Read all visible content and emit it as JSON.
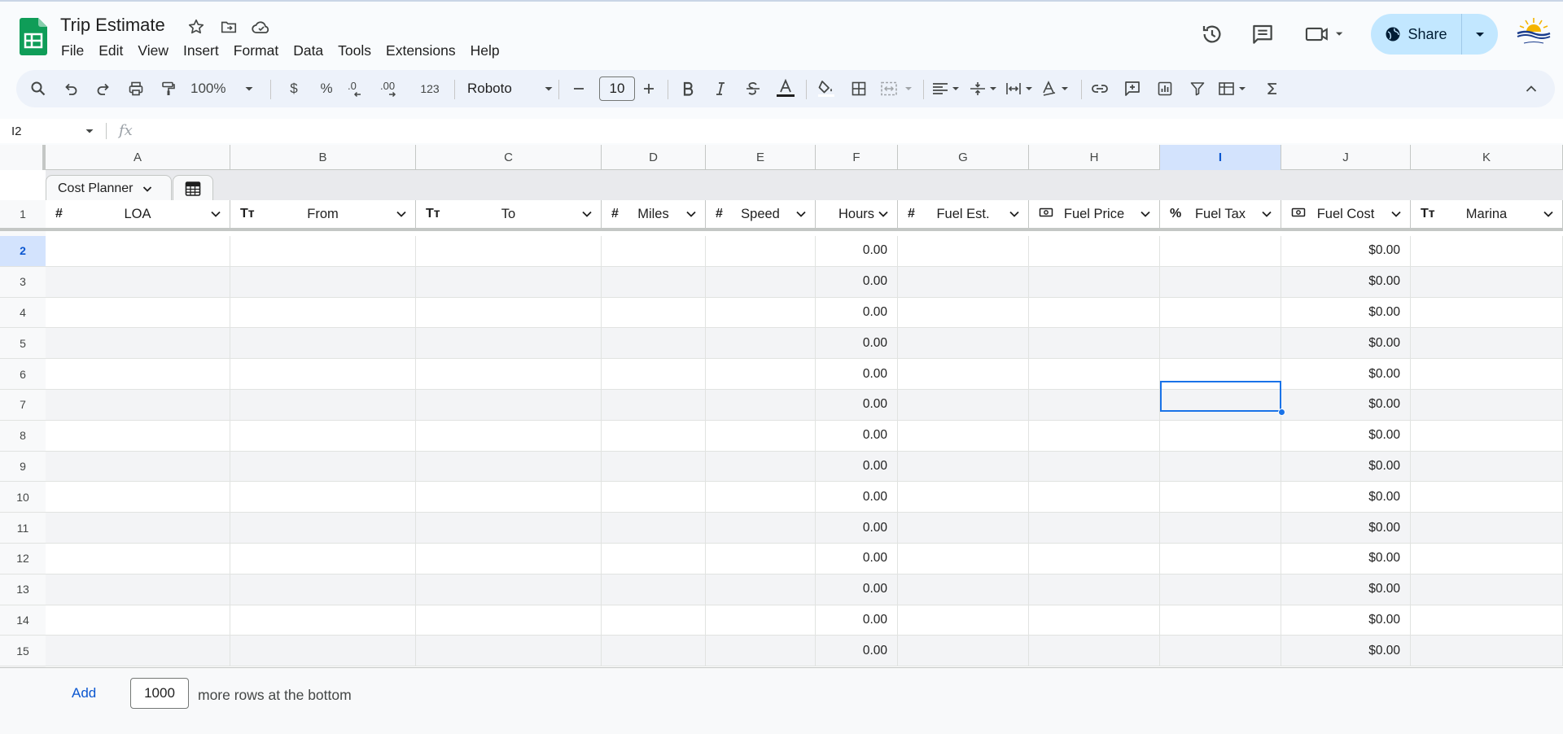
{
  "app": {
    "title": "Trip Estimate"
  },
  "menu": [
    "File",
    "Edit",
    "View",
    "Insert",
    "Format",
    "Data",
    "Tools",
    "Extensions",
    "Help"
  ],
  "share": {
    "label": "Share"
  },
  "toolbar": {
    "zoom": "100%",
    "currency": "$",
    "percent": "%",
    "dec_decrease": ".0",
    "dec_increase": ".00",
    "more_formats": "123",
    "font": "Roboto",
    "font_size": "10"
  },
  "formula": {
    "name_box": "I2",
    "fx": "fx"
  },
  "columns": [
    "A",
    "B",
    "C",
    "D",
    "E",
    "F",
    "G",
    "H",
    "I",
    "J",
    "K"
  ],
  "selected_column": "I",
  "table": {
    "name": "Cost Planner",
    "header_row": "1",
    "fields": [
      {
        "type": "#",
        "label": "LOA"
      },
      {
        "type": "Tт",
        "label": "From"
      },
      {
        "type": "Tт",
        "label": "To"
      },
      {
        "type": "#",
        "label": "Miles"
      },
      {
        "type": "#",
        "label": "Speed"
      },
      {
        "type": "",
        "label": "Hours"
      },
      {
        "type": "#",
        "label": "Fuel Est."
      },
      {
        "type": "money-icon",
        "label": "Fuel Price"
      },
      {
        "type": "%",
        "label": "Fuel Tax"
      },
      {
        "type": "money-icon",
        "label": "Fuel Cost"
      },
      {
        "type": "Tт",
        "label": "Marina"
      }
    ]
  },
  "rows": [
    {
      "num": "2",
      "hours": "0.00",
      "fuel_cost": "$0.00"
    },
    {
      "num": "3",
      "hours": "0.00",
      "fuel_cost": "$0.00"
    },
    {
      "num": "4",
      "hours": "0.00",
      "fuel_cost": "$0.00"
    },
    {
      "num": "5",
      "hours": "0.00",
      "fuel_cost": "$0.00"
    },
    {
      "num": "6",
      "hours": "0.00",
      "fuel_cost": "$0.00"
    },
    {
      "num": "7",
      "hours": "0.00",
      "fuel_cost": "$0.00"
    },
    {
      "num": "8",
      "hours": "0.00",
      "fuel_cost": "$0.00"
    },
    {
      "num": "9",
      "hours": "0.00",
      "fuel_cost": "$0.00"
    },
    {
      "num": "10",
      "hours": "0.00",
      "fuel_cost": "$0.00"
    },
    {
      "num": "11",
      "hours": "0.00",
      "fuel_cost": "$0.00"
    },
    {
      "num": "12",
      "hours": "0.00",
      "fuel_cost": "$0.00"
    },
    {
      "num": "13",
      "hours": "0.00",
      "fuel_cost": "$0.00"
    },
    {
      "num": "14",
      "hours": "0.00",
      "fuel_cost": "$0.00"
    },
    {
      "num": "15",
      "hours": "0.00",
      "fuel_cost": "$0.00"
    }
  ],
  "selected_row": "2",
  "add_rows": {
    "button": "Add",
    "count": "1000",
    "suffix": "more rows at the bottom"
  },
  "colors": {
    "accent": "#0b57d0",
    "share_bg": "#c2e7ff",
    "selection": "#1a73e8",
    "sheets_green": "#0f9d58"
  }
}
